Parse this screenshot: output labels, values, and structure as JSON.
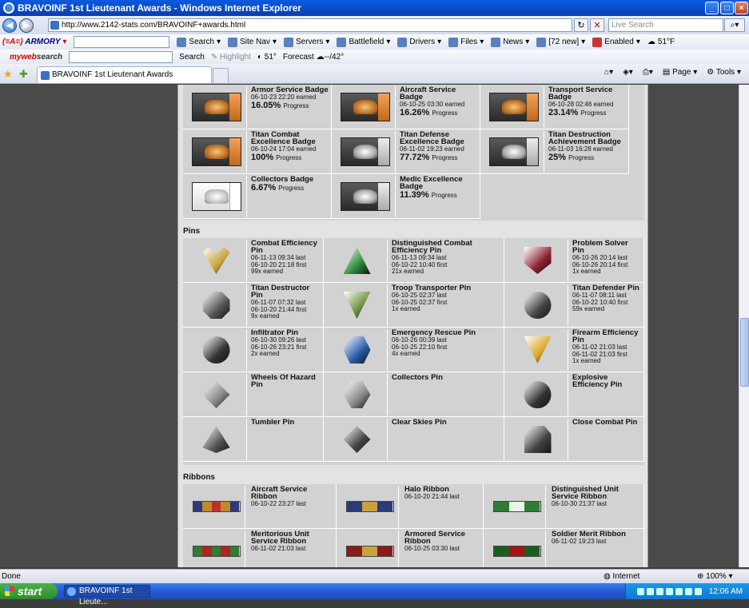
{
  "window": {
    "title": "BRAVOINF 1st Lieutenant Awards - Windows Internet Explorer"
  },
  "address": {
    "url": "http://www.2142-stats.com/BRAVOINF+awards.html",
    "live_search_placeholder": "Live Search"
  },
  "toolbar1": {
    "brand_prefix": "(=A=)",
    "brand": "ARMORY",
    "search": "Search",
    "site_nav": "Site Nav",
    "servers": "Servers",
    "battlefield": "Battlefield",
    "drivers": "Drivers",
    "files": "Files",
    "news": "News",
    "mail_count": "[72 new]",
    "enabled": "Enabled",
    "weather": "51°F"
  },
  "toolbar2": {
    "brand_my": "my",
    "brand_web": "web",
    "brand_search": "search",
    "search_button": "Search",
    "highlight": "Highlight",
    "temp": "51°",
    "forecast": "Forecast",
    "forecast_value": "--/42°"
  },
  "tab": {
    "label": "BRAVOINF 1st Lieutenant Awards"
  },
  "command_bar": {
    "page": "Page",
    "tools": "Tools"
  },
  "badges": [
    {
      "name": "Armor Service Badge",
      "date": "06-10-23 22:20 earned",
      "progress": "16.05%",
      "progress_label": "Progress",
      "style": "bronze"
    },
    {
      "name": "Aircraft Service Badge",
      "date": "06-10-25 03:30 earned",
      "progress": "16.26%",
      "progress_label": "Progress",
      "style": "bronze"
    },
    {
      "name": "Transport Service Badge",
      "date": "06-10-28 02:46 earned",
      "progress": "23.14%",
      "progress_label": "Progress",
      "style": "bronze"
    },
    {
      "name": "Titan Combat Excellence Badge",
      "date": "06-10-24 17:04 earned",
      "progress": "100%",
      "progress_label": "Progress",
      "style": "bronze"
    },
    {
      "name": "Titan Defense Excellence Badge",
      "date": "06-11-02 19:23 earned",
      "progress": "77.72%",
      "progress_label": "Progress",
      "style": "silver"
    },
    {
      "name": "Titan Destruction Achievement Badge",
      "date": "06-11-03 16:28 earned",
      "progress": "25%",
      "progress_label": "Progress",
      "style": "silver"
    },
    {
      "name": "Collectors Badge",
      "date": "",
      "progress": "6.67%",
      "progress_label": "Progress",
      "style": "white"
    },
    {
      "name": "Medic Excellence Badge",
      "date": "",
      "progress": "11.39%",
      "progress_label": "Progress",
      "style": "silver"
    }
  ],
  "pins_header": "Pins",
  "pins": [
    {
      "name": "Combat Efficiency Pin",
      "last": "06-11-13 09:34 last",
      "first": "06-10-20 21:18 first",
      "count": "99x earned",
      "color": "#c9a23a"
    },
    {
      "name": "Distinguished Combat Efficiency Pin",
      "last": "06-11-13 09:34 last",
      "first": "06-10-22 10:40 first",
      "count": "21x earned",
      "color": "#2e8b3a"
    },
    {
      "name": "Problem Solver Pin",
      "last": "06-10-26 20:14 last",
      "first": "06-10-26 20:14 first",
      "count": "1x earned",
      "color": "#8b1e2e"
    },
    {
      "name": "Titan Destructor Pin",
      "last": "06-11-07 07:32 last",
      "first": "06-10-20 21:44 first",
      "count": "9x earned",
      "color": "#555555"
    },
    {
      "name": "Troop Transporter Pin",
      "last": "06-10-25 02:37 last",
      "first": "06-10-25 02:37 first",
      "count": "1x earned",
      "color": "#6a8f3a"
    },
    {
      "name": "Titan Defender Pin",
      "last": "06-11-07 08:11 last",
      "first": "06-10-22 10:40 first",
      "count": "59x earned",
      "color": "#444444"
    },
    {
      "name": "Infiltrator Pin",
      "last": "06-10-30 09:26 last",
      "first": "06-10-26 23:21 first",
      "count": "2x earned",
      "color": "#333333"
    },
    {
      "name": "Emergency Rescue Pin",
      "last": "06-10-26 00:39 last",
      "first": "06-10-25 22:10 first",
      "count": "4x earned",
      "color": "#2a5aa8"
    },
    {
      "name": "Firearm Efficiency Pin",
      "last": "06-11-02 21:03 last",
      "first": "06-11-02 21:03 first",
      "count": "1x earned",
      "color": "#d9a520"
    },
    {
      "name": "Wheels Of Hazard Pin",
      "last": "",
      "first": "",
      "count": "",
      "color": "#888888"
    },
    {
      "name": "Collectors Pin",
      "last": "",
      "first": "",
      "count": "",
      "color": "#888888"
    },
    {
      "name": "Explosive Efficiency Pin",
      "last": "",
      "first": "",
      "count": "",
      "color": "#333333"
    },
    {
      "name": "Tumbler Pin",
      "last": "",
      "first": "",
      "count": "",
      "color": "#555555"
    },
    {
      "name": "Clear Skies Pin",
      "last": "",
      "first": "",
      "count": "",
      "color": "#444444"
    },
    {
      "name": "Close Combat Pin",
      "last": "",
      "first": "",
      "count": "",
      "color": "#444444"
    }
  ],
  "ribbons_header": "Ribbons",
  "ribbons": [
    {
      "name": "Aircraft Service Ribbon",
      "date": "06-10-22 23:27 last",
      "colors": [
        "#2a3a7a",
        "#c08a2a",
        "#c0302a",
        "#c08a2a",
        "#2a3a7a"
      ]
    },
    {
      "name": "Halo Ribbon",
      "date": "06-10-20 21:44 last",
      "colors": [
        "#2a3a7a",
        "#c9a23a",
        "#2a3a7a"
      ]
    },
    {
      "name": "Distinguished Unit Service Ribbon",
      "date": "06-10-30 21:37 last",
      "colors": [
        "#2e7d32",
        "#e8f5e8",
        "#2e7d32"
      ]
    },
    {
      "name": "Meritorious Unit Service Ribbon",
      "date": "06-11-02 21:03 last",
      "colors": [
        "#2e7d32",
        "#b22222",
        "#2e7d32",
        "#b22222",
        "#2e7d32"
      ]
    },
    {
      "name": "Armored Service Ribbon",
      "date": "06-10-25 03:30 last",
      "colors": [
        "#8b1a1a",
        "#c9a23a",
        "#8b1a1a"
      ]
    },
    {
      "name": "Soldier Merit Ribbon",
      "date": "06-11-02 19:23 last",
      "colors": [
        "#1b5e20",
        "#a11",
        "#1b5e20"
      ]
    }
  ],
  "status": {
    "text": "Done",
    "zone": "Internet",
    "zoom": "100%"
  },
  "taskbar": {
    "start": "start",
    "task": "BRAVOINF 1st Lieute...",
    "clock": "12:06 AM"
  }
}
